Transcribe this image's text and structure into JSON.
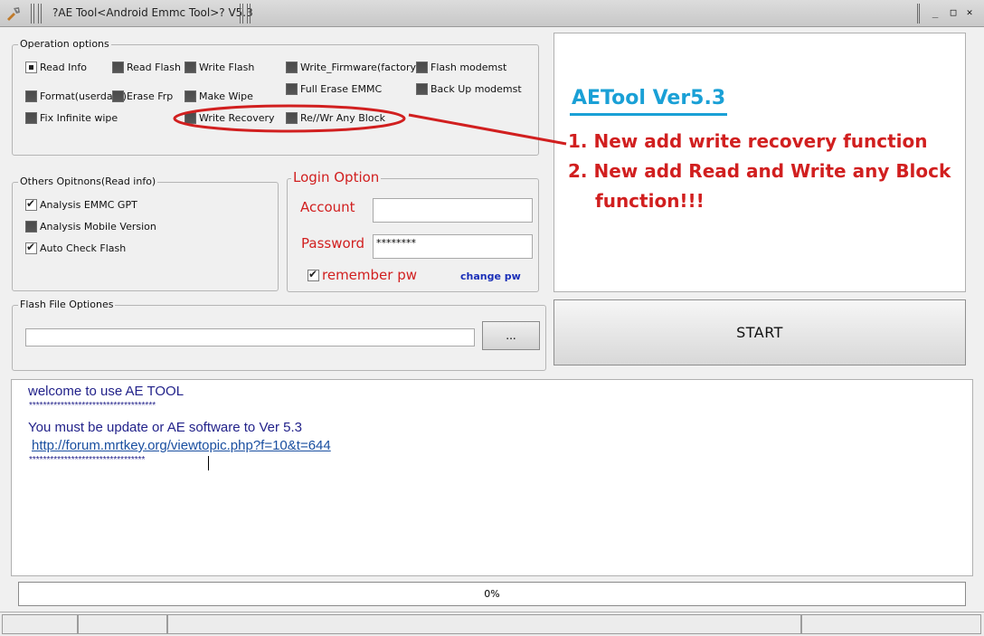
{
  "window": {
    "title": "?AE Tool<Android Emmc Tool>? V5.3",
    "controls": [
      "minimize",
      "maximize",
      "close"
    ]
  },
  "operation_options": {
    "title": "Operation options",
    "items": [
      {
        "label": "Read Info",
        "state": "radio-selected"
      },
      {
        "label": "Read Flash"
      },
      {
        "label": "Write Flash"
      },
      {
        "label": "Write_Firmware(factory)"
      },
      {
        "label": "Flash modemst"
      },
      {
        "label": "Format(userdata)"
      },
      {
        "label": "Erase Frp"
      },
      {
        "label": "Make Wipe"
      },
      {
        "label": "Full Erase EMMC"
      },
      {
        "label": "Back Up modemst"
      },
      {
        "label": "Fix Infinite wipe"
      },
      {
        "label": "Write Recovery"
      },
      {
        "label": "Re//Wr Any Block"
      }
    ]
  },
  "others_options": {
    "title": "Others Opitnons(Read info)",
    "items": [
      {
        "label": "Analysis EMMC GPT",
        "checked": true
      },
      {
        "label": "Analysis Mobile Version",
        "checked": false
      },
      {
        "label": "Auto Check Flash",
        "checked": true
      }
    ]
  },
  "login": {
    "title": "Login Option",
    "account_label": "Account",
    "account_value": "",
    "password_label": "Password",
    "password_value": "********",
    "remember_label": "remember pw",
    "remember_checked": true,
    "change_pw_link": "change pw"
  },
  "flash_file": {
    "title": "Flash File Optiones",
    "path_value": "",
    "browse_label": "..."
  },
  "annotation": {
    "title": "AETool Ver5.3",
    "line1": "1. New add write recovery function",
    "line2": "2. New add Read and Write any Block",
    "line3": "function!!!",
    "colors": {
      "title": "#1aa0d6",
      "text": "#d11f1f"
    }
  },
  "start_button": {
    "label": "START"
  },
  "log": {
    "line1": "welcome to use AE TOOL",
    "line2": "************************************",
    "line3": "You must be update or AE software to Ver 5.3",
    "line4": "http://forum.mrtkey.org/viewtopic.php?f=10&t=644",
    "line5": "*********************************"
  },
  "progress": {
    "label": "0%",
    "value": 0
  }
}
